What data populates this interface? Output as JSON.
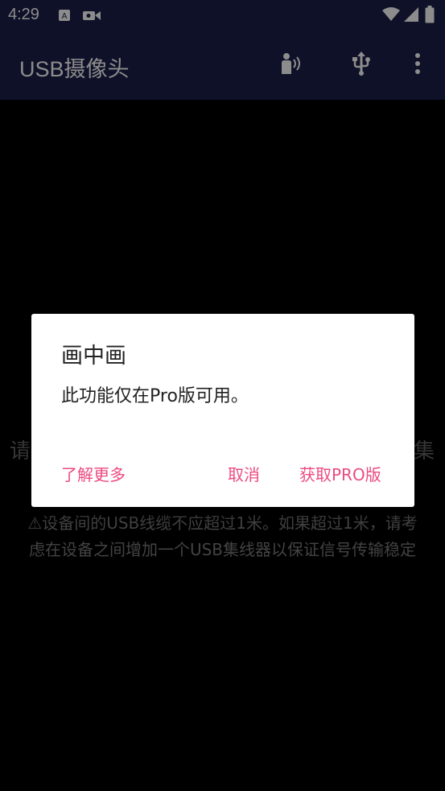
{
  "status_bar": {
    "time": "4:29"
  },
  "app_bar": {
    "title": "USB摄像头",
    "icons": [
      "voice-icon",
      "usb-icon",
      "more-vert-icon"
    ]
  },
  "background": {
    "hint_left": "请",
    "hint_right": "集",
    "warning_line1": "⚠设备间的USB线缆不应超过1米。如果超过1米，请考",
    "warning_line2": "虑在设备之间增加一个USB集线器以保证信号传输稳定"
  },
  "dialog": {
    "title": "画中画",
    "message": "此功能仅在Pro版可用。",
    "learn_more": "了解更多",
    "cancel": "取消",
    "get_pro": "获取PRO版"
  },
  "colors": {
    "appbar": "#1b1f4a",
    "accent": "#ec4a82"
  }
}
